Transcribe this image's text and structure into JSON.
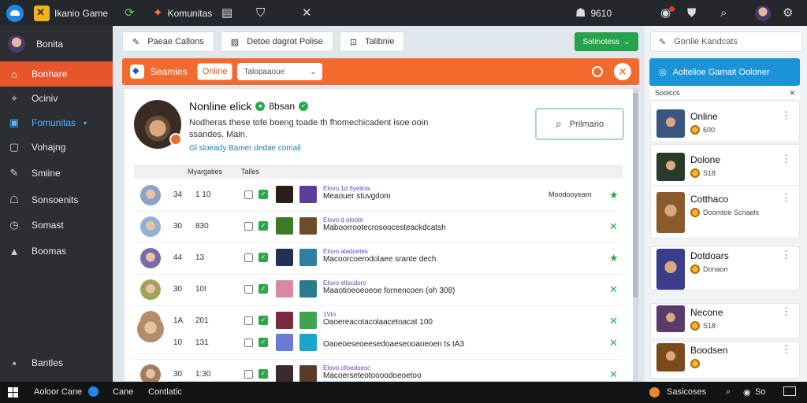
{
  "topbar": {
    "app_title": "Ikanio Game",
    "tab_label": "Komunitas",
    "coins": "9610"
  },
  "sidebar": {
    "items": [
      {
        "label": "Bonita",
        "icon": "user-avatar-icon"
      },
      {
        "label": "Bonhare",
        "icon": "home-icon"
      },
      {
        "label": "Ociniv",
        "icon": "compass-icon"
      },
      {
        "label": "Fomunitas",
        "icon": "community-icon"
      },
      {
        "label": "Vohajng",
        "icon": "grid-icon"
      },
      {
        "label": "Smiine",
        "icon": "tool-icon"
      },
      {
        "label": "Sonsoenits",
        "icon": "gamepad-icon"
      },
      {
        "label": "Somast",
        "icon": "clock-icon"
      },
      {
        "label": "Boomas",
        "icon": "lock-icon"
      },
      {
        "label": "Bantles",
        "icon": "settings-icon"
      }
    ]
  },
  "toolbar": {
    "buttons": [
      "Paeae Callons",
      "Detoe dagrot Polise",
      "Talibnie"
    ],
    "green_button": "Sotinotess"
  },
  "orange_bar": {
    "title": "Seamies",
    "pill": "Online",
    "select_value": "Talopaaoue"
  },
  "profile": {
    "name": "Nonline elick",
    "status": "8bsan",
    "description": "Nodheras these tofe boeng toade th fhomechicadent isoe ooin ssandes. Main.",
    "link": "Gl sloeady Bamer dedae comail",
    "search_label": "Prilmario"
  },
  "table": {
    "headers": [
      "Myargaties",
      "Talles"
    ],
    "rows": [
      {
        "c1": "34",
        "c2": "1 10",
        "meta": "Elovo 1d 6yeiinis",
        "desc": "Meaouer stuvgdom",
        "tail": "Moodooyeam",
        "av": "#8aa3c8",
        "t1": "#2b1d19",
        "t2": "#5b3e9a"
      },
      {
        "c1": "30",
        "c2": "830",
        "meta": "Elovo d oloote",
        "desc": "Maboorrootecrosoocesteackdcatsh",
        "tail": "",
        "av": "#8fb2d6",
        "t1": "#3c7a25",
        "t2": "#6d4c2b"
      },
      {
        "c1": "44",
        "c2": "13",
        "meta": "Elovo aladoetes",
        "desc": "Macoorcoerodolaee srante dech",
        "tail": "",
        "av": "#7a6aa8",
        "t1": "#223055",
        "t2": "#2e7fa0"
      },
      {
        "c1": "30",
        "c2": "10l",
        "meta": "Elovo ellocdoro",
        "desc": "Maaotioeoeoeoe fornencoen (oh 308)",
        "tail": "",
        "av": "#a0a25a",
        "t1": "#d58aa2",
        "t2": "#2a7c8c"
      },
      {
        "c1": "1A",
        "c2": "201",
        "meta": "1Vlo",
        "desc": "Oaoereacotacolaacetoacat 100",
        "tail": "",
        "av": "#b58b6a",
        "t1": "#7a2a3c",
        "t2": "#3fa34f"
      },
      {
        "c1": "10",
        "c2": "131",
        "meta": "",
        "desc": "Oaoeoeseoeesedoaeseooaoeoen ts tA3",
        "tail": "",
        "av": "",
        "t1": "#6b7bd8",
        "t2": "#1ba5c9"
      },
      {
        "c1": "30",
        "c2": "1:30",
        "meta": "Elovo clloedoesc",
        "desc": "Macoerseteotoooodoeoetoo",
        "tail": "",
        "av": "#a67a5c",
        "t1": "#3a2a2f",
        "t2": "#5a3a2a"
      }
    ]
  },
  "right_panel": {
    "search": "Gonlie Kandcats",
    "blue_button": "Aoltelioe Gamait Ooloner",
    "list_header": "Sooiccs",
    "cards": [
      {
        "name": "Online",
        "sub": "600",
        "color": "#3a5580"
      },
      {
        "name": "Dolone",
        "sub": "S18",
        "color": "#2a3a2a"
      },
      {
        "name": "Cotthaco",
        "sub": "Doomtoe Scnaels",
        "color": "#8a5a2a"
      },
      {
        "name": "Dotdoars",
        "sub": "Donaon",
        "color": "#3a3d8a"
      },
      {
        "name": "Necone",
        "sub": "S18",
        "color": "#5a3a6a"
      },
      {
        "name": "Boodsen",
        "sub": "",
        "color": "#7a4a1a"
      }
    ]
  },
  "taskbar": {
    "app_name": "Aoloor Cane",
    "items": [
      "Cane",
      "Contlatic"
    ],
    "right_label": "Sasicoses",
    "sound_label": "So"
  }
}
